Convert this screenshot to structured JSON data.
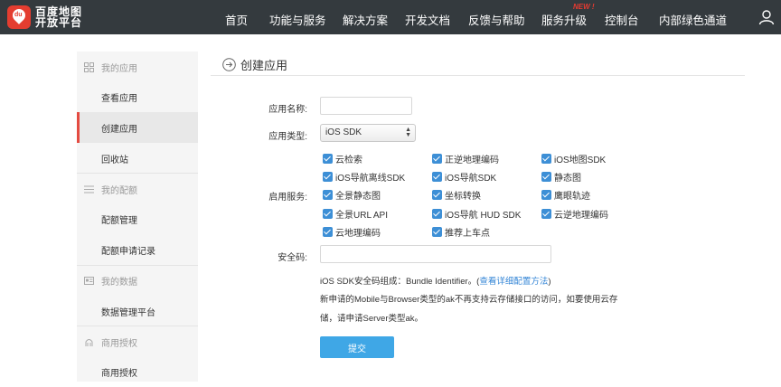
{
  "header": {
    "logo_line1": "百度地图",
    "logo_line2": "开放平台",
    "logo_badge": "du",
    "nav": [
      {
        "label": "首页"
      },
      {
        "label": "功能与服务"
      },
      {
        "label": "解决方案"
      },
      {
        "label": "开发文档"
      },
      {
        "label": "反馈与帮助"
      },
      {
        "label": "服务升级"
      },
      {
        "label": "控制台"
      },
      {
        "label": "内部绿色通道"
      }
    ],
    "new_badge": "NEW !",
    "icons": {
      "user": "user-icon"
    }
  },
  "sidebar": {
    "groups": [
      {
        "title": "我的应用",
        "icon": "grid-icon",
        "items": [
          "查看应用",
          "创建应用",
          "回收站"
        ]
      },
      {
        "title": "我的配额",
        "icon": "list-icon",
        "items": [
          "配额管理",
          "配额申请记录"
        ]
      },
      {
        "title": "我的数据",
        "icon": "id-card-icon",
        "items": [
          "数据管理平台"
        ]
      },
      {
        "title": "商用授权",
        "icon": "hand-icon",
        "items": [
          "商用授权"
        ]
      }
    ],
    "active_item": "创建应用"
  },
  "main": {
    "title": "创建应用",
    "form": {
      "app_name_label": "应用名称:",
      "app_name_value": "",
      "app_type_label": "应用类型:",
      "app_type_value": "iOS SDK",
      "services_label": "启用服务:",
      "services": [
        {
          "label": "云检索",
          "checked": true
        },
        {
          "label": "正逆地理编码",
          "checked": true
        },
        {
          "label": "iOS地图SDK",
          "checked": true
        },
        {
          "label": "iOS导航离线SDK",
          "checked": true
        },
        {
          "label": "iOS导航SDK",
          "checked": true
        },
        {
          "label": "静态图",
          "checked": true
        },
        {
          "label": "全景静态图",
          "checked": true
        },
        {
          "label": "坐标转换",
          "checked": true
        },
        {
          "label": "鹰眼轨迹",
          "checked": true
        },
        {
          "label": "全景URL API",
          "checked": true
        },
        {
          "label": "iOS导航 HUD SDK",
          "checked": true
        },
        {
          "label": "云逆地理编码",
          "checked": true
        },
        {
          "label": "云地理编码",
          "checked": true
        },
        {
          "label": "推荐上车点",
          "checked": true
        }
      ],
      "security_label": "安全码:",
      "security_value": "",
      "note_line1_prefix": "iOS SDK安全码组成：Bundle Identifier。(",
      "note_link": "查看详细配置方法",
      "note_line1_suffix": ")",
      "note_line2": "新申请的Mobile与Browser类型的ak不再支持云存储接口的访问，如要使用云存",
      "note_line3": "储，请申请Server类型ak。",
      "submit_label": "提交"
    }
  },
  "colors": {
    "topbar": "#343a3e",
    "accent": "#e44b41",
    "checkbox": "#3d8fd6",
    "button": "#3fa7e6",
    "link": "#3385d6"
  }
}
